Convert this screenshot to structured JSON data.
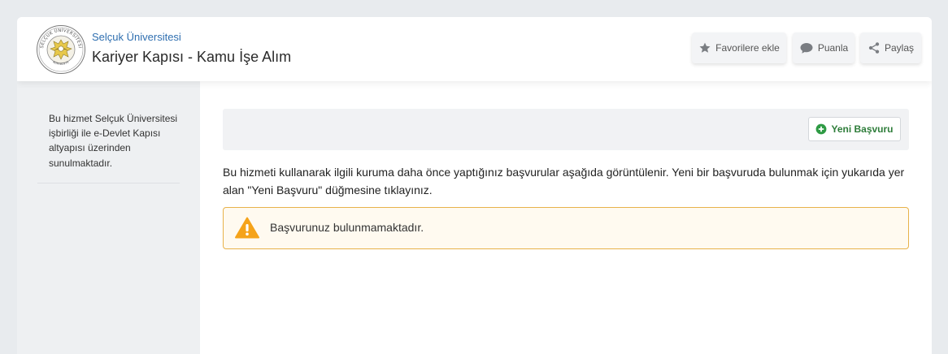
{
  "header": {
    "institution": "Selçuk Üniversitesi",
    "service_title": "Kariyer Kapısı - Kamu İşe Alım",
    "logo": {
      "ring_text": "SELÇUK ÜNİVERSİTESİ",
      "city": "KONYA",
      "year": "1975"
    },
    "actions": {
      "favorite": {
        "label": "Favorilere ekle",
        "icon": "star-icon"
      },
      "rate": {
        "label": "Puanla",
        "icon": "speech-bubble-icon"
      },
      "share": {
        "label": "Paylaş",
        "icon": "share-icon"
      }
    }
  },
  "sidebar": {
    "note": "Bu hizmet Selçuk Üniversitesi işbirliği ile e-Devlet Kapısı altyapısı üzerinden sunulmaktadır."
  },
  "main": {
    "new_application": {
      "label": "Yeni Başvuru",
      "icon": "plus-circle-icon"
    },
    "info_text": "Bu hizmeti kullanarak ilgili kuruma daha önce yaptığınız başvurular aşağıda görüntülenir. Yeni bir başvuruda bulunmak için yukarıda yer alan \"Yeni Başvuru\" düğmesine tıklayınız.",
    "alert": {
      "text": "Başvurunuz bulunmamaktadır.",
      "icon": "warning-icon"
    }
  },
  "colors": {
    "accent_blue": "#2f6fb0",
    "success_green": "#2e7d3a",
    "warning_amber": "#f5a31a"
  }
}
